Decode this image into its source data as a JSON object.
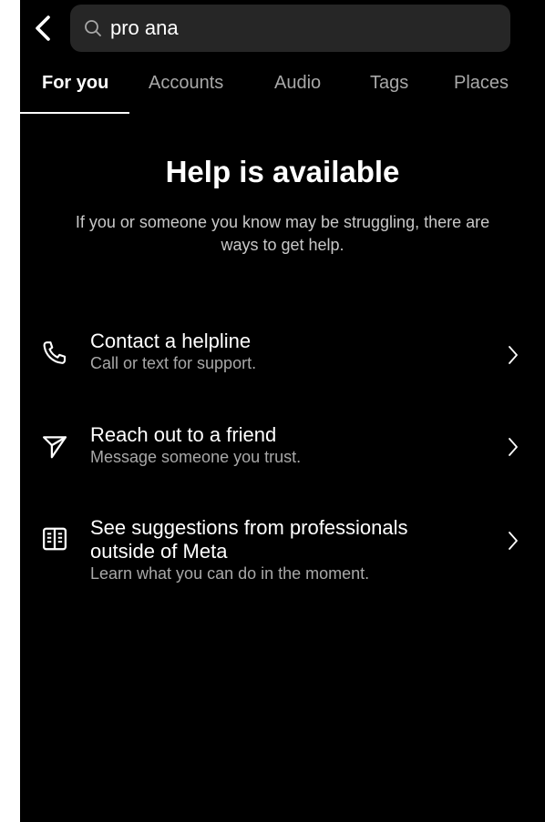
{
  "search": {
    "query": "pro ana"
  },
  "tabs": [
    {
      "label": "For you",
      "active": true
    },
    {
      "label": "Accounts",
      "active": false
    },
    {
      "label": "Audio",
      "active": false
    },
    {
      "label": "Tags",
      "active": false
    },
    {
      "label": "Places",
      "active": false
    }
  ],
  "help": {
    "title": "Help is available",
    "subtitle": "If you or someone you know may be struggling, there are ways to get help."
  },
  "options": [
    {
      "icon": "phone-icon",
      "title": "Contact a helpline",
      "description": "Call or text for support."
    },
    {
      "icon": "send-icon",
      "title": "Reach out to a friend",
      "description": "Message someone you trust."
    },
    {
      "icon": "book-icon",
      "title": "See suggestions from professionals outside of Meta",
      "description": "Learn what you can do in the moment."
    }
  ],
  "colors": {
    "background": "#000000",
    "search_bg": "#262626",
    "text_primary": "#ffffff",
    "text_secondary": "#a8a8a8"
  }
}
